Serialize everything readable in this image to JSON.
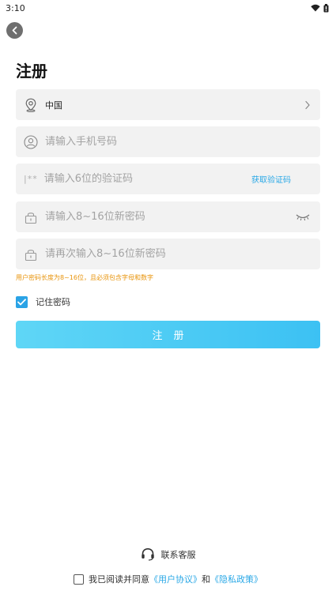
{
  "status_bar": {
    "time": "3:10",
    "icons": [
      "wifi-icon",
      "battery-icon"
    ]
  },
  "header": {
    "back_icon": "chevron-left-icon",
    "title": "注册"
  },
  "form": {
    "country": {
      "icon": "location-pin-icon",
      "value": "中国",
      "chevron": "chevron-right-icon"
    },
    "phone": {
      "icon": "user-circle-icon",
      "placeholder": "请输入手机号码",
      "value": ""
    },
    "code": {
      "icon_text": "|**",
      "placeholder": "请输入6位的验证码",
      "value": "",
      "get_code_label": "获取验证码"
    },
    "password": {
      "icon": "lock-icon",
      "placeholder": "请输入8~16位新密码",
      "value": "",
      "visibility_icon": "eye-closed-icon"
    },
    "confirm_password": {
      "icon": "lock-icon",
      "placeholder": "请再次输入8~16位新密码",
      "value": ""
    },
    "hint": "用户密码长度为8~16位，且必须包含字母和数字",
    "remember": {
      "checked": true,
      "label": "记住密码"
    },
    "submit_label": "注册"
  },
  "footer": {
    "support_icon": "headset-icon",
    "support_label": "联系客服",
    "agreement": {
      "checked": false,
      "prefix": "我已阅读并同意",
      "user_agreement": "《用户协议》",
      "connector": "和",
      "privacy_policy": "《隐私政策》"
    }
  },
  "colors": {
    "accent": "#2aa8e6",
    "button_gradient_start": "#5fd6f6",
    "button_gradient_end": "#3cc1f3",
    "hint": "#e8940c",
    "field_background": "#f2f2f2"
  }
}
